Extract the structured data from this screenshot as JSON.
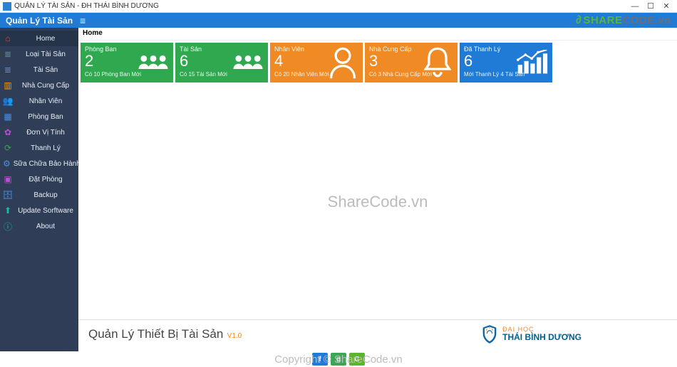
{
  "window": {
    "title": "QUẢN LÝ TÀI SẢN - ĐH THÁI BÌNH DƯƠNG",
    "min": "—",
    "max": "☐",
    "close": "✕"
  },
  "topbar": {
    "title": "Quản Lý Tài Sản"
  },
  "logo": {
    "brand_a": "SHARE",
    "brand_b": "CODE",
    "suffix": ".vn"
  },
  "sidebar": {
    "items": [
      {
        "label": "Home",
        "icon_color": "#e74c3c"
      },
      {
        "label": "Loại Tài Sản",
        "icon_color": "#4a90e2"
      },
      {
        "label": "Tài Sản",
        "icon_color": "#4a90e2"
      },
      {
        "label": "Nhà Cung Cấp",
        "icon_color": "#f39c12"
      },
      {
        "label": "Nhân Viên",
        "icon_color": "#f39c12"
      },
      {
        "label": "Phòng Ban",
        "icon_color": "#4a90e2"
      },
      {
        "label": "Đơn Vị Tính",
        "icon_color": "#b84fd6"
      },
      {
        "label": "Thanh Lý",
        "icon_color": "#2fa84f"
      },
      {
        "label": "Sữa Chữa Bảo Hành",
        "icon_color": "#4a90e2"
      },
      {
        "label": "Đặt Phòng",
        "icon_color": "#b84fd6"
      },
      {
        "label": "Backup",
        "icon_color": "#4a90e2"
      },
      {
        "label": "Update Sorftware",
        "icon_color": "#1abc9c"
      },
      {
        "label": "About",
        "icon_color": "#1abc9c"
      }
    ]
  },
  "breadcrumb": "Home",
  "cards": [
    {
      "title": "Phòng Ban",
      "count": "2",
      "sub": "Có 10 Phòng Ban Mới",
      "kind": "users",
      "palette": "green"
    },
    {
      "title": "Tài Sản",
      "count": "6",
      "sub": "Có 15 Tài Sản Mới",
      "kind": "users",
      "palette": "green"
    },
    {
      "title": "Nhân Viên",
      "count": "4",
      "sub": "Có 20 Nhân Viên Mới",
      "kind": "person",
      "palette": "orange"
    },
    {
      "title": "Nhà Cung Cấp",
      "count": "3",
      "sub": "Có 3 Nhà Cung Cấp Mới",
      "kind": "bell",
      "palette": "orange"
    },
    {
      "title": "Đã Thanh Lý",
      "count": "6",
      "sub": "Mới Thanh Lý 4 Tài Sản",
      "kind": "chart",
      "palette": "blue"
    }
  ],
  "watermark": "ShareCode.vn",
  "footer": {
    "title": "Quản Lý Thiết Bị Tài Sản",
    "version": "V1.0",
    "uni_line1": "ĐẠI HỌC",
    "uni_line2": "THÁI BÌNH DƯƠNG"
  },
  "bottom": {
    "copyright": "Copyright © ShareCode.vn"
  }
}
